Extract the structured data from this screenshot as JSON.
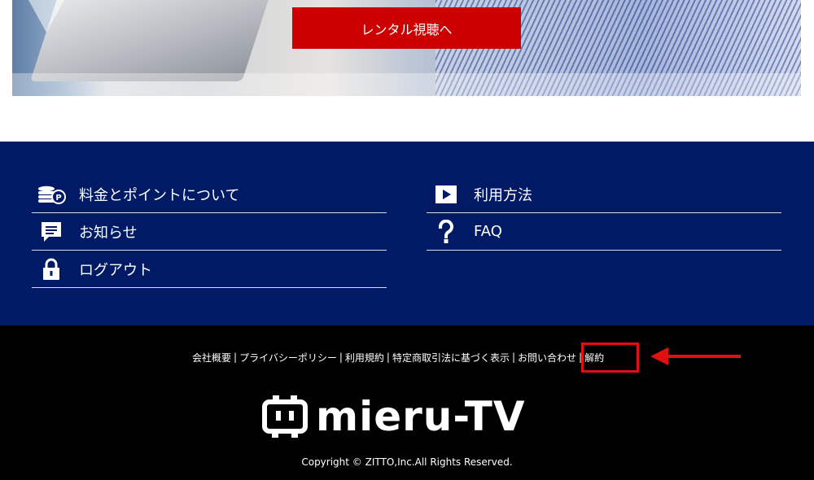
{
  "hero": {
    "rental_button": "レンタル視聴へ"
  },
  "nav": {
    "left": [
      {
        "label": "料金とポイントについて",
        "icon": "coins-points-icon"
      },
      {
        "label": "お知らせ",
        "icon": "message-icon"
      },
      {
        "label": "ログアウト",
        "icon": "lock-icon"
      }
    ],
    "right": [
      {
        "label": "利用方法",
        "icon": "play-icon"
      },
      {
        "label": "FAQ",
        "icon": "question-icon"
      }
    ]
  },
  "footer": {
    "links": [
      "会社概要",
      "プライバシーポリシー",
      "利用規約",
      "特定商取引法に基づく表示",
      "お問い合わせ",
      "解約"
    ],
    "separator": "|",
    "logo_text": "mieru-TV",
    "copyright": "Copyright © ZITTO,Inc.All Rights Reserved."
  },
  "colors": {
    "rental_button": "#cc0000",
    "nav_background": "#001a66",
    "footer_background": "#000000",
    "annotation": "#e01010"
  }
}
